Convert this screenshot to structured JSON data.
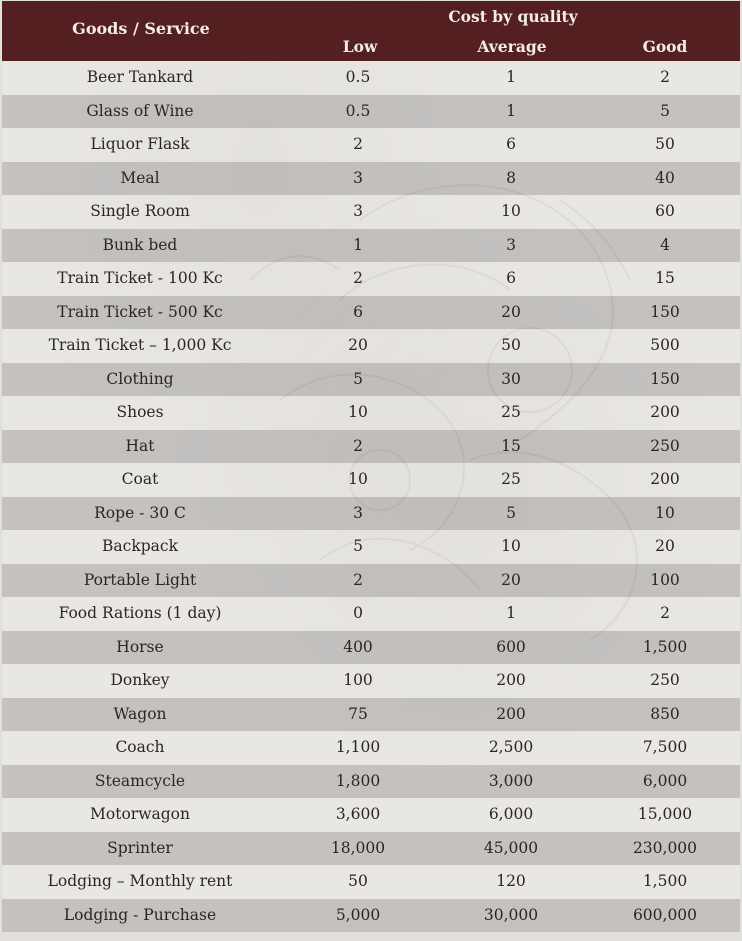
{
  "header": {
    "goods_label": "Goods / Service",
    "cost_label": "Cost by quality",
    "low_label": "Low",
    "average_label": "Average",
    "good_label": "Good"
  },
  "rows": [
    {
      "item": "Beer Tankard",
      "low": "0.5",
      "average": "1",
      "good": "2"
    },
    {
      "item": "Glass of Wine",
      "low": "0.5",
      "average": "1",
      "good": "5"
    },
    {
      "item": "Liquor Flask",
      "low": "2",
      "average": "6",
      "good": "50"
    },
    {
      "item": "Meal",
      "low": "3",
      "average": "8",
      "good": "40"
    },
    {
      "item": "Single Room",
      "low": "3",
      "average": "10",
      "good": "60"
    },
    {
      "item": "Bunk bed",
      "low": "1",
      "average": "3",
      "good": "4"
    },
    {
      "item": "Train Ticket - 100 Kc",
      "low": "2",
      "average": "6",
      "good": "15"
    },
    {
      "item": "Train Ticket - 500 Kc",
      "low": "6",
      "average": "20",
      "good": "150"
    },
    {
      "item": "Train Ticket – 1,000 Kc",
      "low": "20",
      "average": "50",
      "good": "500"
    },
    {
      "item": "Clothing",
      "low": "5",
      "average": "30",
      "good": "150"
    },
    {
      "item": "Shoes",
      "low": "10",
      "average": "25",
      "good": "200"
    },
    {
      "item": "Hat",
      "low": "2",
      "average": "15",
      "good": "250"
    },
    {
      "item": "Coat",
      "low": "10",
      "average": "25",
      "good": "200"
    },
    {
      "item": "Rope - 30 C",
      "low": "3",
      "average": "5",
      "good": "10"
    },
    {
      "item": "Backpack",
      "low": "5",
      "average": "10",
      "good": "20"
    },
    {
      "item": "Portable Light",
      "low": "2",
      "average": "20",
      "good": "100"
    },
    {
      "item": "Food Rations (1 day)",
      "low": "0",
      "average": "1",
      "good": "2"
    },
    {
      "item": "Horse",
      "low": "400",
      "average": "600",
      "good": "1,500"
    },
    {
      "item": "Donkey",
      "low": "100",
      "average": "200",
      "good": "250"
    },
    {
      "item": "Wagon",
      "low": "75",
      "average": "200",
      "good": "850"
    },
    {
      "item": "Coach",
      "low": "1,100",
      "average": "2,500",
      "good": "7,500"
    },
    {
      "item": "Steamcycle",
      "low": "1,800",
      "average": "3,000",
      "good": "6,000"
    },
    {
      "item": "Motorwagon",
      "low": "3,600",
      "average": "6,000",
      "good": "15,000"
    },
    {
      "item": "Sprinter",
      "low": "18,000",
      "average": "45,000",
      "good": "230,000"
    },
    {
      "item": "Lodging – Monthly rent",
      "low": "50",
      "average": "120",
      "good": "1,500"
    },
    {
      "item": "Lodging - Purchase",
      "low": "5,000",
      "average": "30,000",
      "good": "600,000"
    }
  ],
  "colors": {
    "header_bg": "#531f20",
    "header_text": "#f4ece8",
    "row_light": "#e6e4e1",
    "row_dark": "#b9b6b3"
  },
  "icons": [
    "watermark-sketch-icon"
  ]
}
